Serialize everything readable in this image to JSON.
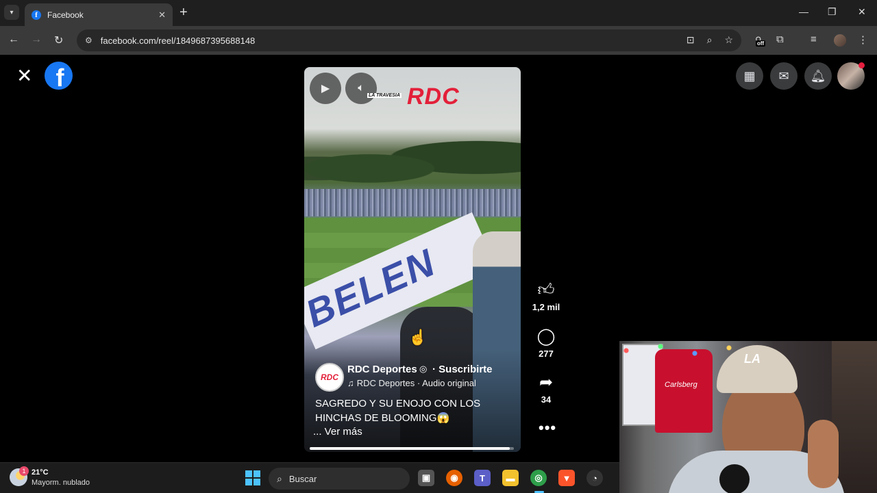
{
  "browser": {
    "tab_title": "Facebook",
    "url": "facebook.com/reel/1849687395688148",
    "ext_badge": "off"
  },
  "facebook": {
    "logo_letter": "f"
  },
  "reel": {
    "watermark_small": "LA TRAVESIA",
    "watermark_brand": "RDC",
    "banner_text": "BELEN",
    "page_avatar_text": "RDC",
    "page_name": "RDC Deportes",
    "subscribe": "· Suscribirte",
    "audio": "RDC Deportes · Audio original",
    "caption": "SAGREDO Y SU ENOJO CON LOS HINCHAS DE BLOOMING😱",
    "see_more": "... Ver más",
    "progress": 0.98
  },
  "actions": {
    "likes": "1,2 mil",
    "comments": "277",
    "shares": "34"
  },
  "webcam": {
    "shirt_text": "Carlsberg",
    "cap_logo": "LA"
  },
  "taskbar": {
    "weather_badge": "1",
    "temperature": "21°C",
    "condition": "Mayorm. nublado",
    "search_placeholder": "Buscar"
  }
}
